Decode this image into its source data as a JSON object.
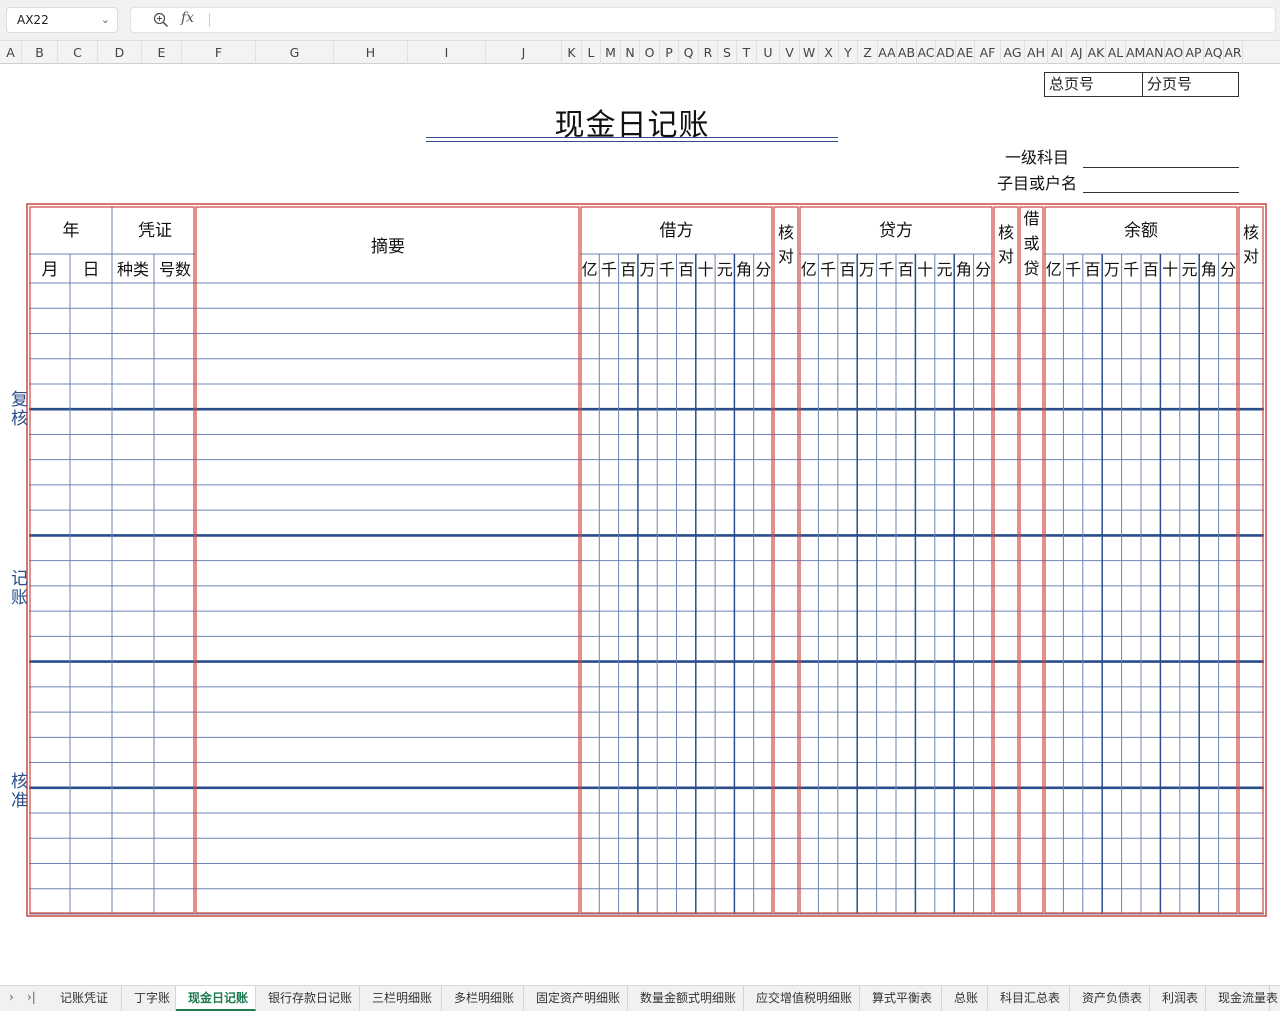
{
  "formula_bar": {
    "cell_ref": "AX22",
    "formula": "",
    "icons": [
      "zoom-icon",
      "fx-icon",
      "chevron-down-icon"
    ]
  },
  "columns": [
    "A",
    "B",
    "C",
    "D",
    "E",
    "F",
    "G",
    "H",
    "I",
    "J",
    "K",
    "L",
    "M",
    "N",
    "O",
    "P",
    "Q",
    "R",
    "S",
    "T",
    "U",
    "V",
    "W",
    "X",
    "Y",
    "Z",
    "AA",
    "AB",
    "AC",
    "AD",
    "AE",
    "AF",
    "AG",
    "AH",
    "AI",
    "AJ",
    "AK",
    "AL",
    "AM",
    "AN",
    "AO",
    "AP",
    "AQ",
    "AR"
  ],
  "sheet": {
    "title": "现金日记账",
    "total_page_label": "总页号",
    "sub_page_label": "分页号",
    "level1_subject_label": "一级科目",
    "sub_subject_label": "子目或户名",
    "header": {
      "year": "年",
      "month": "月",
      "day": "日",
      "voucher": "凭证",
      "voucher_type": "种类",
      "voucher_number": "号数",
      "summary": "摘要",
      "debit": "借方",
      "credit": "贷方",
      "check_1": "核对",
      "check_2": "核对",
      "check_3": "核对",
      "debit_or_credit": "借或贷",
      "balance": "余额",
      "digits": [
        "亿",
        "千",
        "百",
        "万",
        "千",
        "百",
        "十",
        "元",
        "角",
        "分"
      ]
    },
    "side_labels": [
      "复核",
      "记账",
      "核准"
    ],
    "row_count": 25,
    "colors": {
      "red_border": "#d0463f",
      "blue_line": "#2a4e8c",
      "light_blue_line": "#6b84b3"
    }
  },
  "tabs": {
    "items": [
      "记账凭证",
      "丁字账",
      "现金日记账",
      "银行存款日记账",
      "三栏明细账",
      "多栏明细账",
      "固定资产明细账",
      "数量金额式明细账",
      "应交增值税明细账",
      "算式平衡表",
      "总账",
      "科目汇总表",
      "资产负债表",
      "利润表",
      "现金流量表"
    ],
    "active": "现金日记账"
  }
}
